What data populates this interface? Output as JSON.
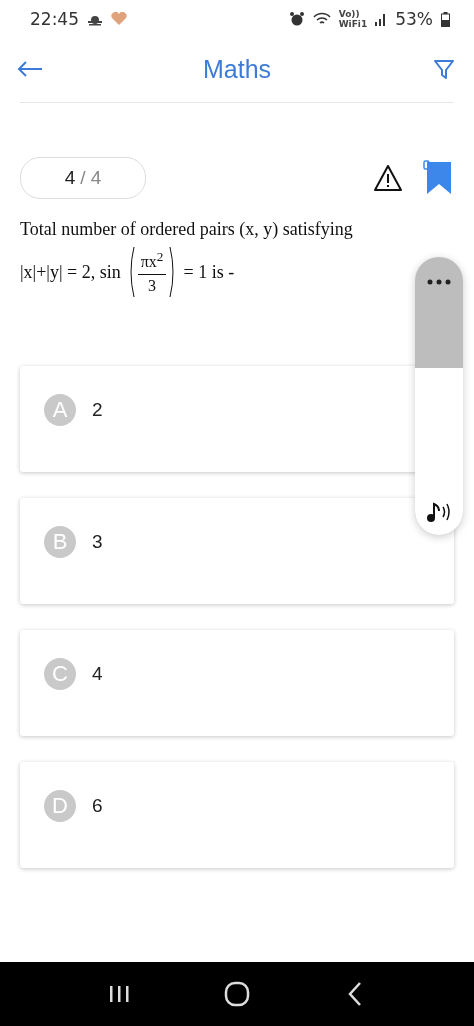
{
  "status_bar": {
    "time": "22:45",
    "network_label": "Vo))",
    "network_sub": "WiFi1",
    "battery": "53%"
  },
  "header": {
    "title": "Maths"
  },
  "counter": {
    "current": "4",
    "separator": "/",
    "total": "4"
  },
  "bookmark": {
    "on": true
  },
  "question": {
    "line1": "Total number of ordered pairs (x, y) satisfying",
    "prefix": "|x|+|y| = 2, sin",
    "numerator": "πx$^{2}$",
    "denominator": "3",
    "suffix": "= 1 is -"
  },
  "options": [
    {
      "letter": "A",
      "text": "2",
      "selected": false
    },
    {
      "letter": "B",
      "text": "3",
      "selected": false
    },
    {
      "letter": "C",
      "text": "4",
      "selected": false
    },
    {
      "letter": "D",
      "text": "6",
      "selected": false
    }
  ],
  "volume_panel": {
    "level": 0.6
  }
}
